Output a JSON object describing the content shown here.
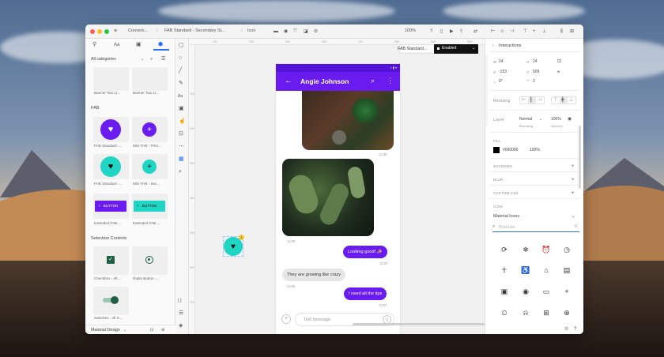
{
  "titlebar": {
    "breadcrumb_1": "Convers...",
    "breadcrumb_2": "FAB Standard - Secondary St...",
    "breadcrumb_3": "Icon",
    "zoom": "100%"
  },
  "library": {
    "tabs": [
      "components",
      "text",
      "image",
      "shapes"
    ],
    "filter": "All categories",
    "banner_items": [
      "Banner Two Li...",
      "Banner Two Li..."
    ],
    "fab_heading": "FAB",
    "fab_items": [
      "FAB Standard -...",
      "Mini FAB - Prim...",
      "FAB Standard -...",
      "Mini FAB - Sec..."
    ],
    "extended_items": [
      {
        "label": "Extended FAB ...",
        "button": "BUTTON",
        "plus": "+"
      },
      {
        "label": "Extended FAB ...",
        "button": "BUTTON",
        "plus": "+"
      }
    ],
    "selection_heading": "Selection Controls",
    "selection_items": [
      "Checkbox - All ...",
      "Radio Button -...",
      "Switches - All S..."
    ],
    "footer": "Material Design"
  },
  "canvas": {
    "frame_label": "FAB Standard...",
    "state_label": "Enabled",
    "ruler_top": [
      "200",
      "250",
      "300",
      "350",
      "400",
      "450",
      "500",
      "550"
    ],
    "ruler_left": [
      "100",
      "200",
      "300",
      "400",
      "500",
      "600",
      "700"
    ],
    "badge": "1",
    "chat": {
      "title": "Angie Johnson",
      "time_1": "12:30",
      "time_2": "12:30",
      "msg_out_1": "Looking good! ✨",
      "time_3": "12:57",
      "msg_in": "They are growing like crazy",
      "time_4": "13:05",
      "msg_out_2": "I need all the tips",
      "time_5": "13:07",
      "input_placeholder": "Text message"
    }
  },
  "props": {
    "header": "Interactions",
    "w": "24",
    "h": "24",
    "x": "-153",
    "y": "509",
    "r": "0°",
    "corner": "2",
    "resizing_label": "Resizing",
    "layer_label": "Layer",
    "blend": "Normal",
    "opacity": "100%",
    "blend_sub": "Blending",
    "opacity_sub": "Opacity",
    "fill_label": "FILL",
    "fill_hex": "#000000",
    "fill_opacity": "100%",
    "shadows": "SHADOWS",
    "blur": "BLUR",
    "custom_css": "CUSTOM CSS",
    "icon_label": "ICON",
    "icon_set": "Material Icons",
    "search_placeholder": "Find icon",
    "icons": [
      "sync-icon",
      "snowflake-icon",
      "alarm-icon",
      "clock-icon",
      "accessibility-icon",
      "wheelchair-icon",
      "bank-icon",
      "wallet-icon",
      "contact-icon",
      "account-icon",
      "ticket-icon",
      "add-icon",
      "alarm-add-icon",
      "alarm-bell-icon",
      "add-box-icon",
      "add-circle-icon"
    ]
  },
  "colors": {
    "purple": "#6a1cf0",
    "teal": "#21d5c4",
    "titlebar": "#f4f4f4"
  }
}
